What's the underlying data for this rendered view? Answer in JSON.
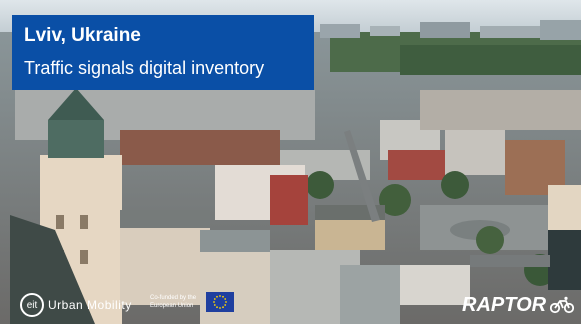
{
  "title": {
    "main": "Lviv, Ukraine",
    "subtitle": "Traffic signals digital inventory"
  },
  "logos": {
    "eit_mark": "eit",
    "eit_text": "Urban Mobility",
    "eu_text": "Co-funded by the European Union",
    "raptor_text": "RAPTOR"
  },
  "colors": {
    "title_box": "#0a4fa6",
    "eu_flag": "#1f3f9f",
    "eu_stars": "#ffd400"
  },
  "icons": {
    "eit": "eit-circle-logo-icon",
    "eu": "eu-flag-icon",
    "raptor": "bicycle-icon"
  }
}
